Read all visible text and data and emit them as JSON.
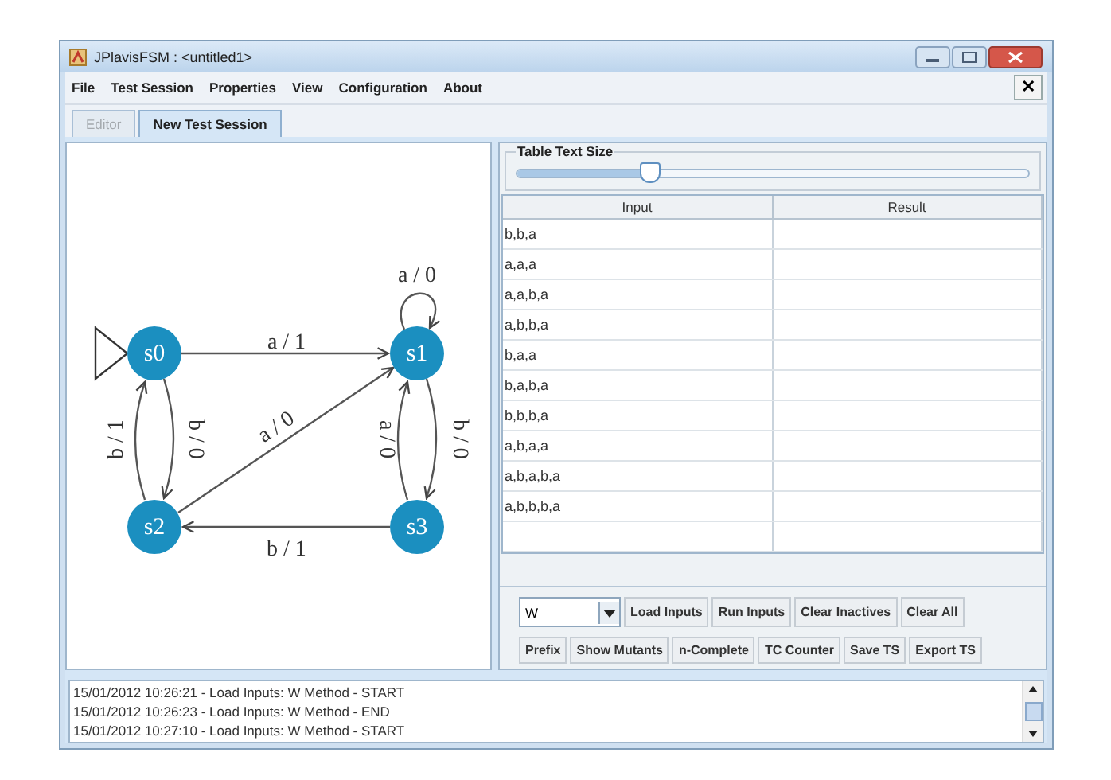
{
  "window": {
    "title": "JPlavisFSM : <untitled1>"
  },
  "menu": [
    "File",
    "Test Session",
    "Properties",
    "View",
    "Configuration",
    "About"
  ],
  "menu_close": "✕",
  "tabs": [
    {
      "label": "Editor",
      "selected": false,
      "disabled": true
    },
    {
      "label": "New Test Session",
      "selected": true,
      "disabled": false
    }
  ],
  "diagram": {
    "states": [
      {
        "label": "s0",
        "initial": true
      },
      {
        "label": "s1",
        "initial": false
      },
      {
        "label": "s2",
        "initial": false
      },
      {
        "label": "s3",
        "initial": false
      }
    ],
    "transitions": [
      {
        "label": "a / 1"
      },
      {
        "label": "a / 0"
      },
      {
        "label": "b / 0"
      },
      {
        "label": "b / 1"
      },
      {
        "label": "a / 0"
      },
      {
        "label": "b / 0"
      },
      {
        "label": "a / 0"
      },
      {
        "label": "b / 1"
      }
    ]
  },
  "text_size": {
    "title": "Table Text Size",
    "level": 0.26
  },
  "table": {
    "columns": [
      "Input",
      "Result"
    ],
    "rows": [
      {
        "input": "b,b,a"
      },
      {
        "input": "a,a,a"
      },
      {
        "input": "a,a,b,a"
      },
      {
        "input": "a,b,b,a"
      },
      {
        "input": "b,a,a"
      },
      {
        "input": "b,a,b,a"
      },
      {
        "input": "b,b,b,a"
      },
      {
        "input": "a,b,a,a"
      },
      {
        "input": "a,b,a,b,a"
      },
      {
        "input": "a,b,b,b,a"
      }
    ]
  },
  "method_select": {
    "value": "W"
  },
  "buttons_row_1": [
    "Load Inputs",
    "Run Inputs",
    "Clear Inactives",
    "Clear All"
  ],
  "buttons_row_2": [
    "Prefix",
    "Show Mutants",
    "n-Complete",
    "TC Counter",
    "Save TS",
    "Export TS"
  ],
  "log": [
    "15/01/2012 10:26:21 - Load Inputs: W Method - START",
    "15/01/2012 10:26:23 - Load Inputs: W Method - END",
    "15/01/2012 10:27:10 - Load Inputs: W Method - START"
  ]
}
